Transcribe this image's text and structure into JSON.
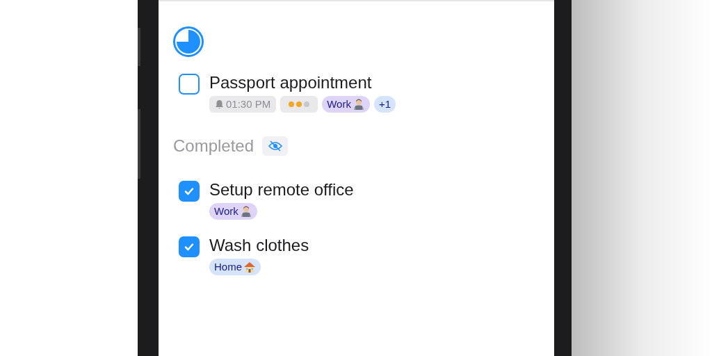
{
  "tasks": [
    {
      "title": "Passport appointment",
      "checked": false,
      "tags": [
        {
          "kind": "time",
          "text": "01:30 PM"
        },
        {
          "kind": "priority",
          "level": 0.67
        },
        {
          "kind": "work",
          "text": "Work",
          "color": "#ddd4f8"
        },
        {
          "kind": "count",
          "text": "+1",
          "color": "#d6e4fb"
        }
      ]
    }
  ],
  "completed": {
    "title": "Completed",
    "hidden": true,
    "tasks": [
      {
        "title": "Setup remote office",
        "checked": true,
        "tags": [
          {
            "kind": "work",
            "text": "Work",
            "color": "#ddd4f8"
          }
        ]
      },
      {
        "title": "Wash clothes",
        "checked": true,
        "tags": [
          {
            "kind": "home",
            "text": "Home",
            "color": "#d6e4fb"
          }
        ]
      }
    ]
  }
}
